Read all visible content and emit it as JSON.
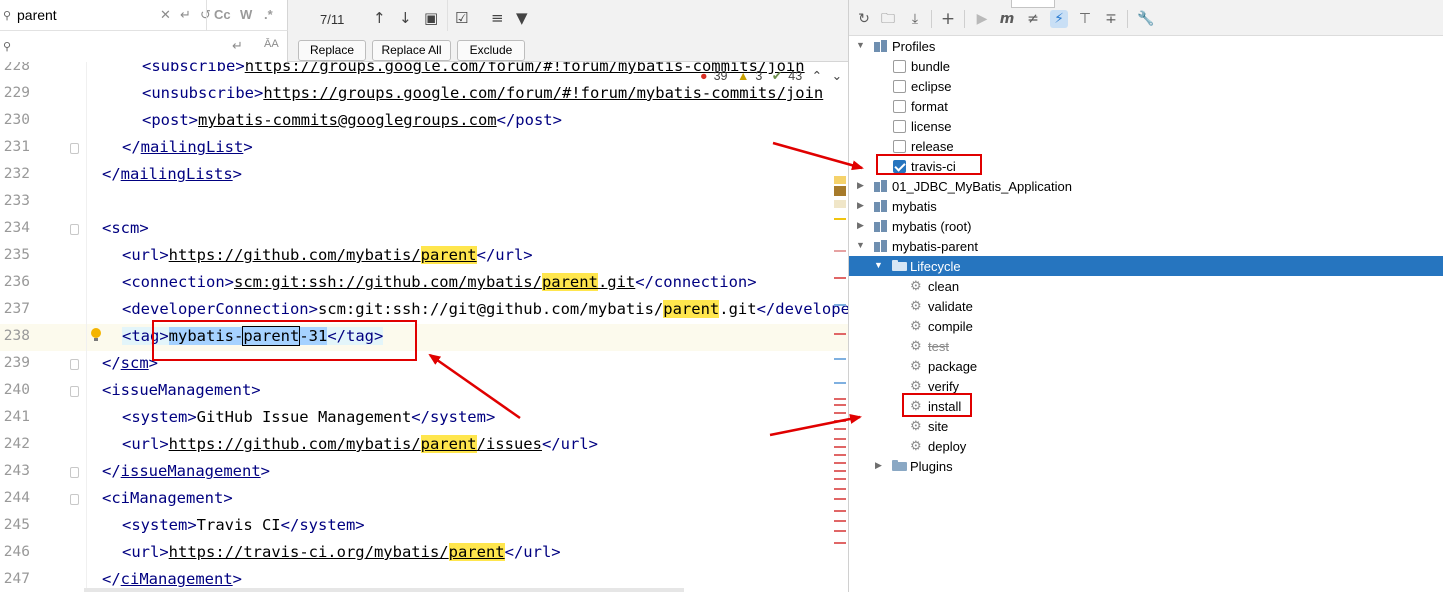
{
  "find_bar": {
    "search_value": "parent",
    "replace_value": "",
    "match_count": "7/11",
    "option_match_case": "Cc",
    "option_words": "W",
    "option_regex": ".*",
    "replace_button": "Replace",
    "replace_all_button": "Replace All",
    "exclude_button": "Exclude"
  },
  "inspections": {
    "errors": "39",
    "warnings": "3",
    "weak_warnings": "43"
  },
  "editor": {
    "lines": [
      {
        "num": "228",
        "indent": 2,
        "tokens": [
          {
            "t": "<",
            "c": "tag"
          },
          {
            "t": "subscribe",
            "c": "tag"
          },
          {
            "t": ">",
            "c": "tag"
          },
          {
            "t": "https://groups.google.com/forum/#!forum/mybatis-commits/join",
            "c": "url"
          }
        ]
      },
      {
        "num": "229",
        "indent": 2,
        "tokens": [
          {
            "t": "<unsubscribe>",
            "c": "tag"
          },
          {
            "t": "https://groups.google.com/forum/#!forum/mybatis-commits/join",
            "c": "url"
          }
        ]
      },
      {
        "num": "230",
        "indent": 2,
        "tokens": [
          {
            "t": "<post>",
            "c": "tag"
          },
          {
            "t": "mybatis-commits@googlegroups.com",
            "c": "url"
          },
          {
            "t": "</post>",
            "c": "tag"
          }
        ]
      },
      {
        "num": "231",
        "indent": 1,
        "tokens": [
          {
            "t": "</",
            "c": "tag"
          },
          {
            "t": "mailingList",
            "c": "tagu"
          },
          {
            "t": ">",
            "c": "tag"
          }
        ]
      },
      {
        "num": "232",
        "indent": 0,
        "tokens": [
          {
            "t": "</",
            "c": "tag"
          },
          {
            "t": "mailingLists",
            "c": "tagu"
          },
          {
            "t": ">",
            "c": "tag"
          }
        ]
      },
      {
        "num": "233",
        "indent": 0,
        "tokens": []
      },
      {
        "num": "234",
        "indent": 0,
        "tokens": [
          {
            "t": "<scm>",
            "c": "tag"
          }
        ]
      },
      {
        "num": "235",
        "indent": 1,
        "tokens": [
          {
            "t": "<url>",
            "c": "tag"
          },
          {
            "t": "https://github.com/mybatis/",
            "c": "url"
          },
          {
            "t": "parent",
            "c": "urlhl"
          },
          {
            "t": "</url>",
            "c": "tag"
          }
        ]
      },
      {
        "num": "236",
        "indent": 1,
        "tokens": [
          {
            "t": "<connection>",
            "c": "tag"
          },
          {
            "t": "scm:git:ssh://github.com/mybatis/",
            "c": "url"
          },
          {
            "t": "parent",
            "c": "urlhl"
          },
          {
            "t": ".git",
            "c": "url"
          },
          {
            "t": "</connection>",
            "c": "tag"
          }
        ]
      },
      {
        "num": "237",
        "indent": 1,
        "tokens": [
          {
            "t": "<developerConnection>",
            "c": "tag"
          },
          {
            "t": "scm:git:ssh://git@github.com/mybatis/",
            "c": "plain"
          },
          {
            "t": "parent",
            "c": "hl"
          },
          {
            "t": ".git",
            "c": "plain"
          },
          {
            "t": "</developerConnection>",
            "c": "tag"
          }
        ]
      },
      {
        "num": "238",
        "indent": 1,
        "current": true,
        "tokens": [
          {
            "t": "<tag>",
            "c": "tagbg"
          },
          {
            "t": "mybatis-",
            "c": "sel"
          },
          {
            "t": "parent",
            "c": "caret"
          },
          {
            "t": "-31",
            "c": "sel"
          },
          {
            "t": "</tag>",
            "c": "tagbg"
          }
        ]
      },
      {
        "num": "239",
        "indent": 0,
        "tokens": [
          {
            "t": "</",
            "c": "tag"
          },
          {
            "t": "scm",
            "c": "tagu"
          },
          {
            "t": ">",
            "c": "tag"
          }
        ]
      },
      {
        "num": "240",
        "indent": 0,
        "tokens": [
          {
            "t": "<issueManagement>",
            "c": "tag"
          }
        ]
      },
      {
        "num": "241",
        "indent": 1,
        "tokens": [
          {
            "t": "<system>",
            "c": "tag"
          },
          {
            "t": "GitHub Issue Management",
            "c": "plain"
          },
          {
            "t": "</system>",
            "c": "tag"
          }
        ]
      },
      {
        "num": "242",
        "indent": 1,
        "tokens": [
          {
            "t": "<url>",
            "c": "tag"
          },
          {
            "t": "https://github.com/mybatis/",
            "c": "url"
          },
          {
            "t": "parent",
            "c": "urlhl"
          },
          {
            "t": "/issues",
            "c": "url"
          },
          {
            "t": "</url>",
            "c": "tag"
          }
        ]
      },
      {
        "num": "243",
        "indent": 0,
        "tokens": [
          {
            "t": "</",
            "c": "tag"
          },
          {
            "t": "issueManagement",
            "c": "tagu"
          },
          {
            "t": ">",
            "c": "tag"
          }
        ]
      },
      {
        "num": "244",
        "indent": 0,
        "tokens": [
          {
            "t": "<ciManagement>",
            "c": "tag"
          }
        ]
      },
      {
        "num": "245",
        "indent": 1,
        "tokens": [
          {
            "t": "<system>",
            "c": "tag"
          },
          {
            "t": "Travis CI",
            "c": "plain"
          },
          {
            "t": "</system>",
            "c": "tag"
          }
        ]
      },
      {
        "num": "246",
        "indent": 1,
        "tokens": [
          {
            "t": "<url>",
            "c": "tag"
          },
          {
            "t": "https://travis-ci.org/mybatis/",
            "c": "url"
          },
          {
            "t": "parent",
            "c": "urlhl"
          },
          {
            "t": "</url>",
            "c": "tag"
          }
        ]
      },
      {
        "num": "247",
        "indent": 0,
        "tokens": [
          {
            "t": "</",
            "c": "tag"
          },
          {
            "t": "ciManagement",
            "c": "tagu"
          },
          {
            "t": ">",
            "c": "tag"
          }
        ]
      }
    ]
  },
  "maven": {
    "toolbar": [
      "reload-icon",
      "add-folder-icon",
      "download-icon",
      "plus-icon",
      "run-icon",
      "execute-goal-icon",
      "skip-tests-icon",
      "offline-mode-icon",
      "expand-all-icon",
      "collapse-all-icon",
      "settings-wrench-icon"
    ],
    "profiles": {
      "label": "Profiles",
      "items": [
        {
          "label": "bundle",
          "checked": false
        },
        {
          "label": "eclipse",
          "checked": false
        },
        {
          "label": "format",
          "checked": false
        },
        {
          "label": "license",
          "checked": false
        },
        {
          "label": "release",
          "checked": false
        },
        {
          "label": "travis-ci",
          "checked": true
        }
      ]
    },
    "modules": [
      "01_JDBC_MyBatis_Application",
      "mybatis",
      "mybatis (root)",
      "mybatis-parent"
    ],
    "lifecycle": {
      "label": "Lifecycle",
      "goals": [
        {
          "label": "clean",
          "skipped": false
        },
        {
          "label": "validate",
          "skipped": false
        },
        {
          "label": "compile",
          "skipped": false
        },
        {
          "label": "test",
          "skipped": true
        },
        {
          "label": "package",
          "skipped": false
        },
        {
          "label": "verify",
          "skipped": false
        },
        {
          "label": "install",
          "skipped": false
        },
        {
          "label": "site",
          "skipped": false
        },
        {
          "label": "deploy",
          "skipped": false
        }
      ]
    },
    "plugins_label": "Plugins"
  },
  "colors": {
    "selection": "#2675bf",
    "search_highlight": "#ffe64d",
    "annotation_red": "#e00000",
    "xml_tag": "#000080"
  }
}
